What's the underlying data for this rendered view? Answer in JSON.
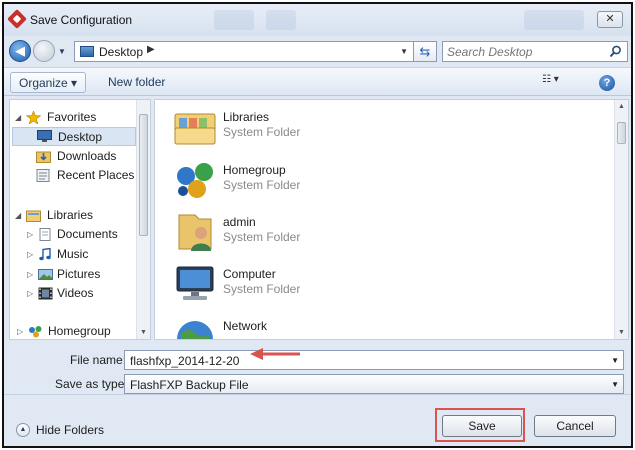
{
  "window": {
    "title": "Save Configuration",
    "close_glyph": "✕"
  },
  "nav": {
    "back_glyph": "◀",
    "address": {
      "location": "Desktop",
      "separator": "▶"
    },
    "refresh_glyph": "⇆",
    "search_placeholder": "Search Desktop"
  },
  "toolbar": {
    "organize_label": "Organize ▾",
    "new_folder_label": "New folder",
    "view_glyph": "☷ ▾",
    "help_glyph": "?"
  },
  "sidebar": {
    "favorites": "Favorites",
    "favorites_items": [
      "Desktop",
      "Downloads",
      "Recent Places"
    ],
    "libraries": "Libraries",
    "libraries_items": [
      "Documents",
      "Music",
      "Pictures",
      "Videos"
    ],
    "homegroup": "Homegroup",
    "expanded_glyph": "◢",
    "collapsed_glyph": "▷"
  },
  "content": {
    "items": [
      {
        "name": "Libraries",
        "type": "System Folder",
        "icon": "libraries-icon"
      },
      {
        "name": "Homegroup",
        "type": "System Folder",
        "icon": "homegroup-icon"
      },
      {
        "name": "admin",
        "type": "System Folder",
        "icon": "user-folder-icon"
      },
      {
        "name": "Computer",
        "type": "System Folder",
        "icon": "computer-icon"
      },
      {
        "name": "Network",
        "type": "",
        "icon": "network-icon"
      }
    ]
  },
  "form": {
    "file_name_label": "File name:",
    "file_name_value": "flashfxp_2014-12-20",
    "save_type_label": "Save as type:",
    "save_type_value": "FlashFXP Backup File"
  },
  "footer": {
    "hide_folders_label": "Hide Folders",
    "save_label": "Save",
    "cancel_label": "Cancel"
  },
  "colors": {
    "annotation": "#d9534f",
    "accent": "#1d5fae"
  }
}
